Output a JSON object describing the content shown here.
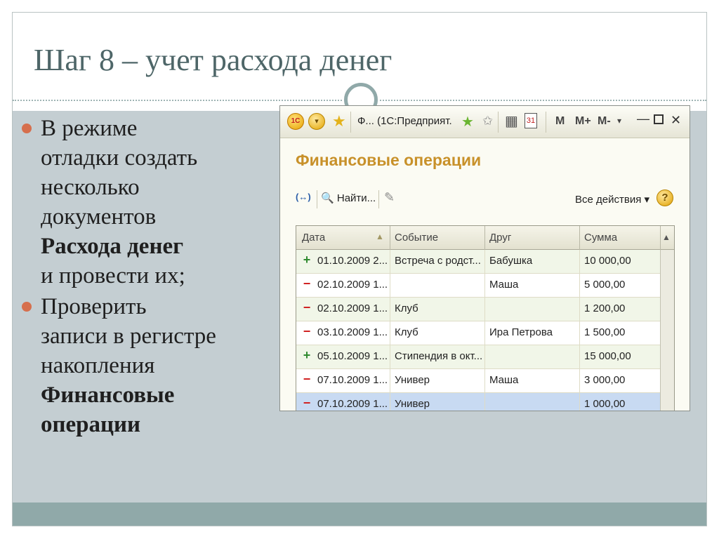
{
  "slide": {
    "title": "Шаг 8 – учет расхода денег",
    "bullets": [
      {
        "lines": [
          "В режиме",
          "отладки создать",
          "несколько",
          "документов"
        ],
        "bold_lines": [
          "Расхода денег"
        ],
        "tail_lines": [
          "и провести их;"
        ]
      },
      {
        "lines": [
          "Проверить",
          "записи в регистре",
          "накопления"
        ],
        "bold_lines": [
          "Финансовые",
          "операции"
        ]
      }
    ],
    "colors": {
      "bullet": "#d66f4d",
      "title": "#4e6668",
      "band": "#90a9a9",
      "content_bg": "#c4ced2"
    }
  },
  "app": {
    "toolbar": {
      "logo_icon": "1c-logo-icon",
      "logo_text": "1С",
      "menu_icon": "menu-dropdown-icon",
      "menu_symbol": "▾",
      "star_symbol": "★",
      "window_title": "Ф... (1С:Предприят.",
      "favorites_symbol": "★",
      "doc_symbol": "✩",
      "calculator_symbol": "▦",
      "calendar_text": "31",
      "memory_buttons": [
        "M",
        "M+",
        "M-"
      ],
      "dropdown_symbol": "▾",
      "minimize_symbol": "—",
      "close_symbol": "✕"
    },
    "form": {
      "title": "Финансовые операции",
      "refresh_symbol": "(↔)",
      "find_symbol": "🔍",
      "find_label": "Найти...",
      "clear_symbol": "✎",
      "all_actions": "Все действия ▾",
      "help_symbol": "?"
    },
    "grid": {
      "columns": [
        "Дата",
        "Событие",
        "Друг",
        "Сумма"
      ],
      "sort_symbol": "▲",
      "scroll_up_symbol": "▲",
      "rows": [
        {
          "sign": "+",
          "type": "plus",
          "date": "01.10.2009 2...",
          "event": "Встреча с родст...",
          "friend": "Бабушка",
          "sum": "10 000,00"
        },
        {
          "sign": "−",
          "type": "minus",
          "date": "02.10.2009 1...",
          "event": "",
          "friend": "Маша",
          "sum": "5 000,00"
        },
        {
          "sign": "−",
          "type": "minus",
          "date": "02.10.2009 1...",
          "event": "Клуб",
          "friend": "",
          "sum": "1 200,00"
        },
        {
          "sign": "−",
          "type": "minus",
          "date": "03.10.2009 1...",
          "event": "Клуб",
          "friend": "Ира Петрова",
          "sum": "1 500,00"
        },
        {
          "sign": "+",
          "type": "plus",
          "date": "05.10.2009 1...",
          "event": "Стипендия в окт...",
          "friend": "",
          "sum": "15 000,00"
        },
        {
          "sign": "−",
          "type": "minus",
          "date": "07.10.2009 1...",
          "event": "Универ",
          "friend": "Маша",
          "sum": "3 000,00"
        },
        {
          "sign": "−",
          "type": "minus",
          "date": "07.10.2009 1...",
          "event": "Универ",
          "friend": "",
          "sum": "1 000,00",
          "selected": true
        }
      ]
    }
  }
}
